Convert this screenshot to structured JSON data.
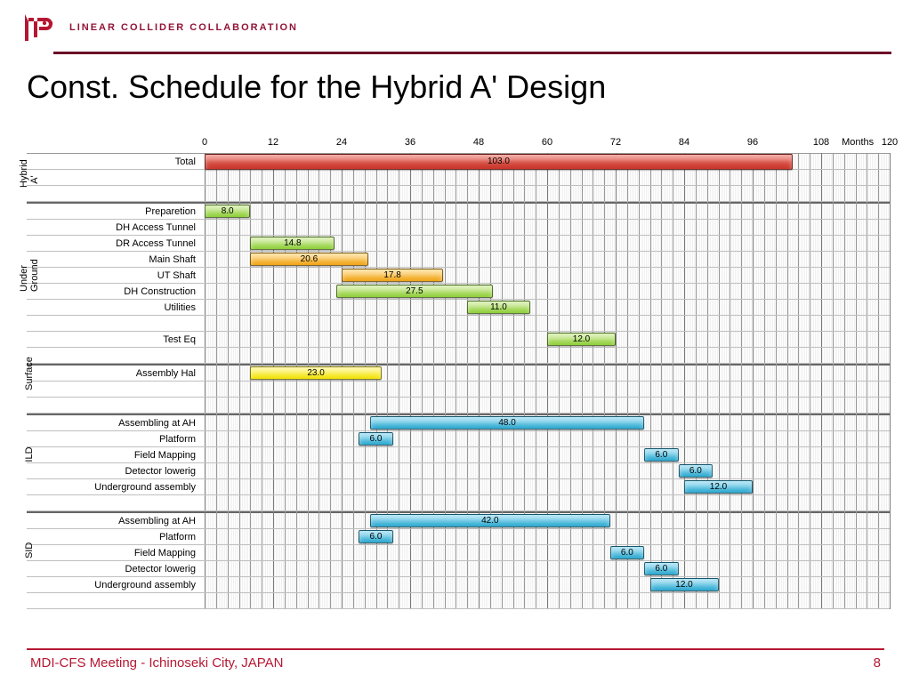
{
  "brand": {
    "name": "LINEAR COLLIDER COLLABORATION"
  },
  "title": "Const. Schedule for the Hybrid A' Design",
  "axis": {
    "ticks": [
      0,
      12,
      24,
      36,
      48,
      60,
      72,
      84,
      96,
      108,
      120
    ],
    "unit": "Months",
    "max": 120
  },
  "groups": [
    {
      "name": "Hybrid A'",
      "rows": [
        "Total",
        "",
        ""
      ]
    },
    {
      "name": "Under Ground",
      "rows": [
        "Preparetion",
        "DH Access Tunnel",
        "DR Access Tunnel",
        "Main Shaft",
        "UT Shaft",
        "DH Construction",
        "Utilities",
        "",
        "Test Eq",
        ""
      ]
    },
    {
      "name": "Surface",
      "rows": [
        "Assembly Hal",
        "",
        ""
      ]
    },
    {
      "name": "ILD",
      "rows": [
        "Assembling at AH",
        "Platform",
        "Field Mapping",
        "Detector lowerig",
        "Underground assembly",
        ""
      ]
    },
    {
      "name": "SID",
      "rows": [
        "Assembling at AH",
        "Platform",
        "Field Mapping",
        "Detector lowerig",
        "Underground assembly",
        ""
      ]
    }
  ],
  "chart_data": {
    "type": "bar",
    "xlabel": "Months",
    "xlim": [
      0,
      120
    ],
    "bars": [
      {
        "group": "Hybrid A'",
        "task": "Total",
        "start": 0,
        "duration": 103.0,
        "color": "red"
      },
      {
        "group": "Under Ground",
        "task": "Preparetion",
        "start": 0,
        "duration": 8.0,
        "color": "green"
      },
      {
        "group": "Under Ground",
        "task": "DR Access Tunnel",
        "start": 8,
        "duration": 14.8,
        "color": "green"
      },
      {
        "group": "Under Ground",
        "task": "Main Shaft",
        "start": 8,
        "duration": 20.6,
        "color": "orange"
      },
      {
        "group": "Under Ground",
        "task": "UT Shaft",
        "start": 24,
        "duration": 17.8,
        "color": "orange"
      },
      {
        "group": "Under Ground",
        "task": "DH Construction",
        "start": 23,
        "duration": 27.5,
        "color": "green"
      },
      {
        "group": "Under Ground",
        "task": "Utilities",
        "start": 46,
        "duration": 11.0,
        "color": "green"
      },
      {
        "group": "Under Ground",
        "task": "Test Eq",
        "start": 60,
        "duration": 12.0,
        "color": "green"
      },
      {
        "group": "Surface",
        "task": "Assembly Hal",
        "start": 8,
        "duration": 23.0,
        "color": "yellow"
      },
      {
        "group": "ILD",
        "task": "Assembling at AH",
        "start": 29,
        "duration": 48.0,
        "color": "blue"
      },
      {
        "group": "ILD",
        "task": "Platform",
        "start": 27,
        "duration": 6.0,
        "color": "blue"
      },
      {
        "group": "ILD",
        "task": "Field Mapping",
        "start": 77,
        "duration": 6.0,
        "color": "blue"
      },
      {
        "group": "ILD",
        "task": "Detector lowerig",
        "start": 83,
        "duration": 6.0,
        "color": "blue"
      },
      {
        "group": "ILD",
        "task": "Underground assembly",
        "start": 84,
        "duration": 12.0,
        "color": "blue"
      },
      {
        "group": "SID",
        "task": "Assembling at AH",
        "start": 29,
        "duration": 42.0,
        "color": "blue"
      },
      {
        "group": "SID",
        "task": "Platform",
        "start": 27,
        "duration": 6.0,
        "color": "blue"
      },
      {
        "group": "SID",
        "task": "Field Mapping",
        "start": 71,
        "duration": 6.0,
        "color": "blue"
      },
      {
        "group": "SID",
        "task": "Detector lowerig",
        "start": 77,
        "duration": 6.0,
        "color": "blue"
      },
      {
        "group": "SID",
        "task": "Underground assembly",
        "start": 78,
        "duration": 12.0,
        "color": "blue"
      }
    ]
  },
  "footer": {
    "text": "MDI-CFS Meeting - Ichinoseki City, JAPAN",
    "page": "8"
  }
}
